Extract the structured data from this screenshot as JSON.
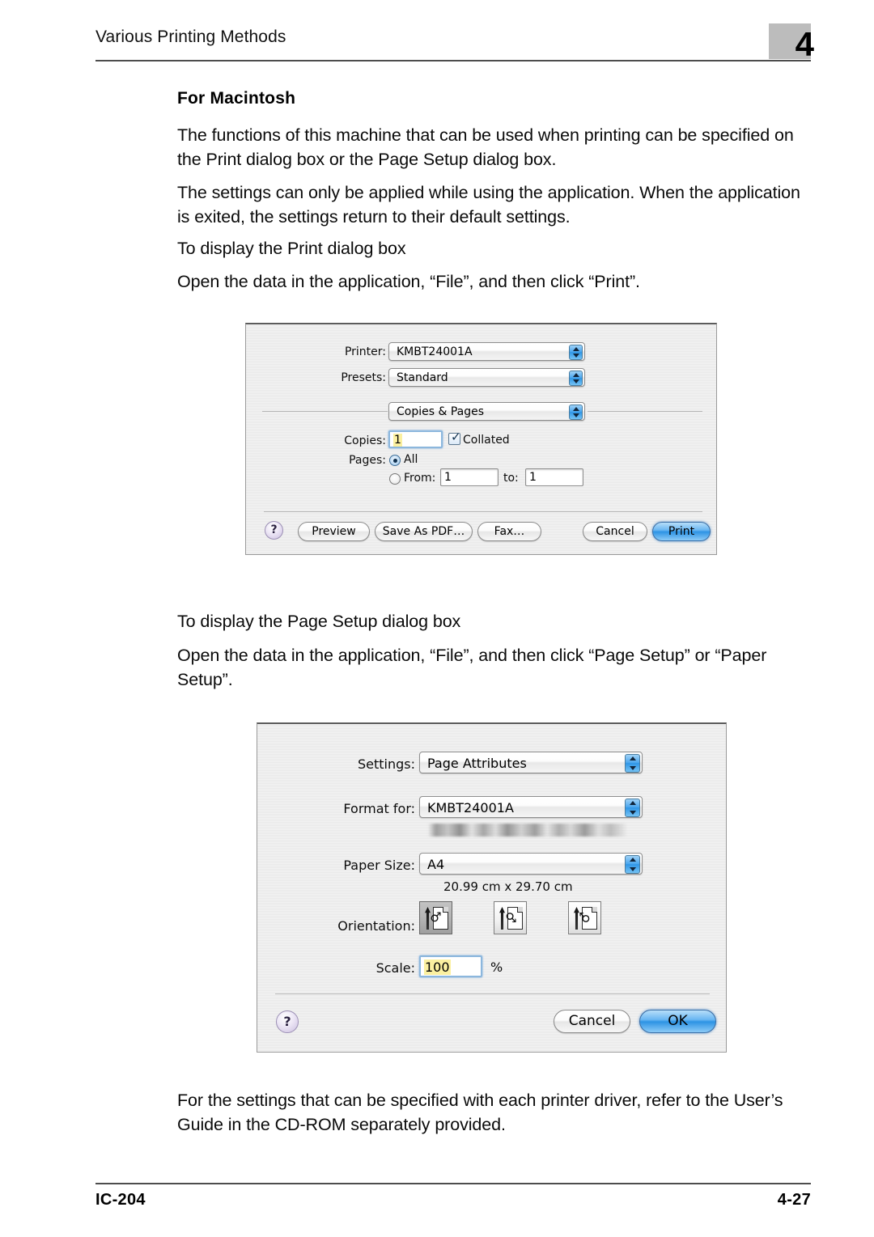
{
  "header": {
    "title": "Various Printing Methods",
    "chapter_number": "4"
  },
  "body": {
    "subhead": "For Macintosh",
    "paragraph_1": "The functions of this machine that can be used when printing can be specified on the Print dialog box or the Page Setup dialog box.",
    "paragraph_2": "The settings can only be applied while using the application. When the application is exited, the settings return to their default settings.",
    "paragraph_3": "To display the Print dialog box",
    "paragraph_4": "Open the data in the application, “File”, and then click “Print”.",
    "paragraph_5": "To display the Page Setup dialog box",
    "paragraph_6": "Open the data in the application, “File”, and then click “Page Setup” or “Paper Setup”.",
    "paragraph_7": "For the settings that can be specified with each printer driver, refer to the User’s Guide in the CD-ROM separately provided."
  },
  "print_dialog": {
    "printer_label": "Printer:",
    "printer_value": "KMBT24001A",
    "presets_label": "Presets:",
    "presets_value": "Standard",
    "pane_value": "Copies & Pages",
    "copies_label": "Copies:",
    "copies_value": "1",
    "collated_label": "Collated",
    "collated_checked": true,
    "pages_label": "Pages:",
    "pages_all_label": "All",
    "pages_all_selected": true,
    "pages_from_label": "From:",
    "pages_from_value": "1",
    "pages_to_label": "to:",
    "pages_to_value": "1",
    "help_label": "?",
    "preview_label": "Preview",
    "save_as_pdf_label": "Save As PDF…",
    "fax_label": "Fax…",
    "cancel_label": "Cancel",
    "print_label": "Print"
  },
  "page_setup_dialog": {
    "settings_label": "Settings:",
    "settings_value": "Page Attributes",
    "format_for_label": "Format for:",
    "format_for_value": "KMBT24001A",
    "format_for_detail": "",
    "paper_size_label": "Paper Size:",
    "paper_size_value": "A4",
    "paper_dimensions": "20.99 cm x 29.70 cm",
    "orientation_label": "Orientation:",
    "orientation_selected_index": 0,
    "scale_label": "Scale:",
    "scale_value": "100",
    "scale_unit": "%",
    "help_label": "?",
    "cancel_label": "Cancel",
    "ok_label": "OK"
  },
  "footer": {
    "left": "IC-204",
    "right": "4-27"
  },
  "colors": {
    "aqua_blue": "#2d93e4",
    "chapter_box": "#bcbcbc",
    "field_highlight": "#fbf0a0",
    "rule": "#4d4d4d"
  }
}
